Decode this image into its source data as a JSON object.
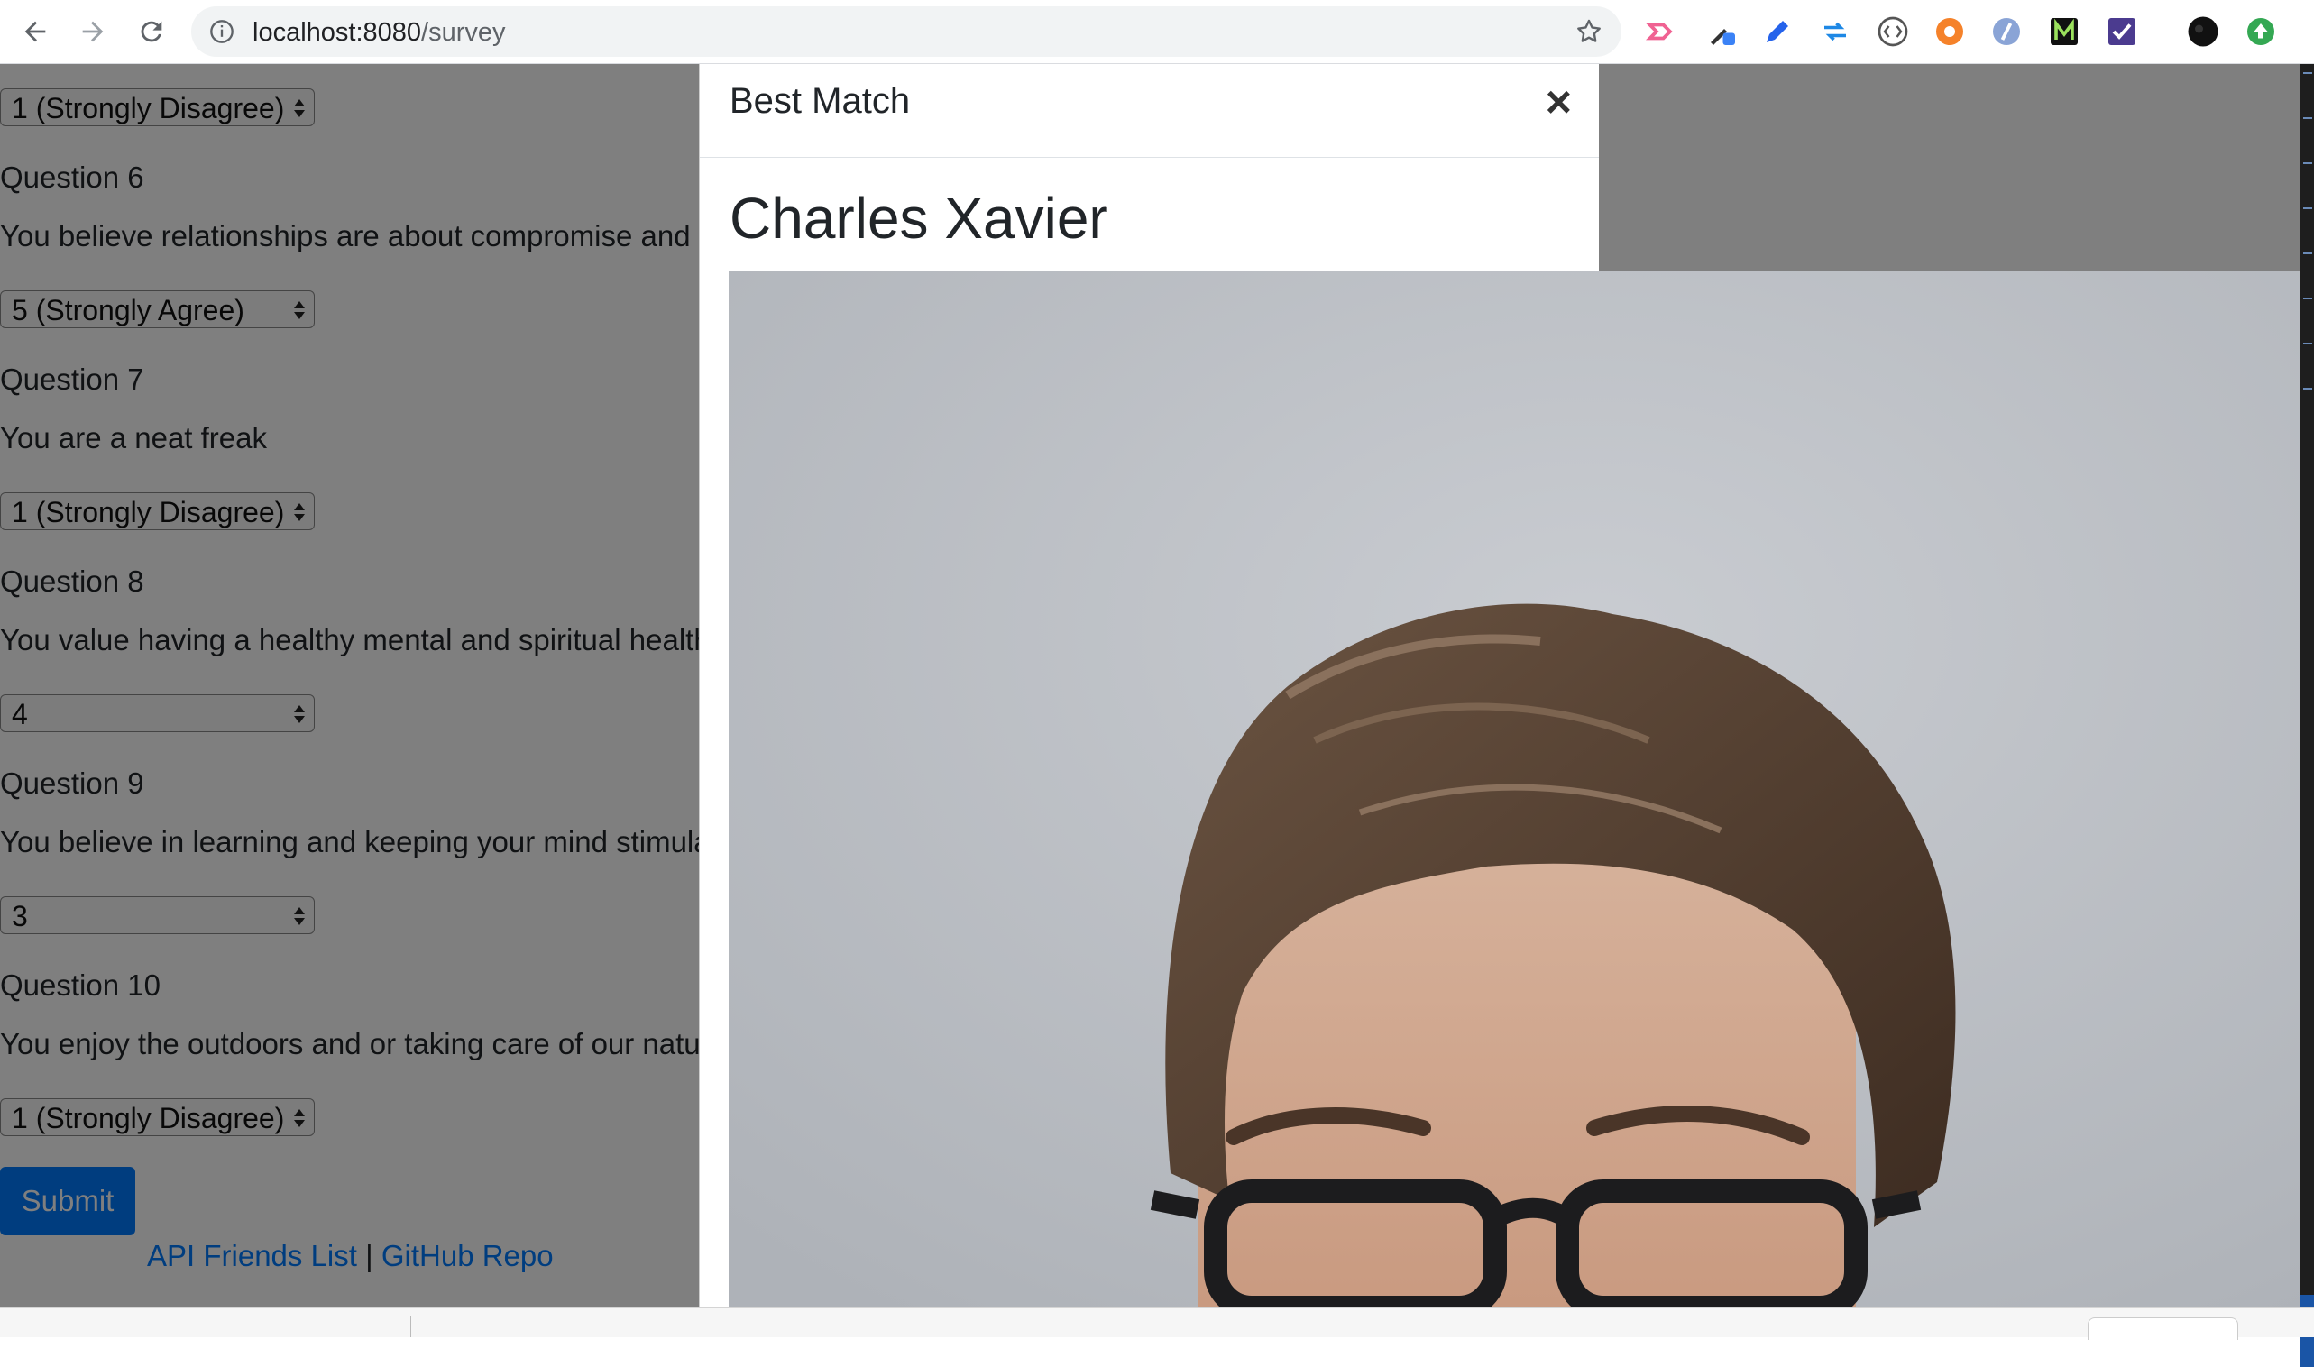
{
  "browser": {
    "url_host": "localhost:8080",
    "url_path": "/survey"
  },
  "survey": {
    "top_select": "1 (Strongly Disagree)",
    "questions": [
      {
        "label": "Question 6",
        "text": "You believe relationships are about compromise and m",
        "answer": "5 (Strongly Agree)"
      },
      {
        "label": "Question 7",
        "text": "You are a neat freak",
        "answer": "1 (Strongly Disagree)"
      },
      {
        "label": "Question 8",
        "text": "You value having a healthy mental and spiritual health",
        "answer": "4"
      },
      {
        "label": "Question 9",
        "text": "You believe in learning and keeping your mind stimulat",
        "answer": "3"
      },
      {
        "label": "Question 10",
        "text": "You enjoy the outdoors and or taking care of our natur",
        "answer": "1 (Strongly Disagree)"
      }
    ],
    "submit_label": "Submit",
    "footer": {
      "link_api": "API Friends List",
      "separator": "|",
      "link_github": "GitHub Repo"
    }
  },
  "modal": {
    "title": "Best Match",
    "close_glyph": "×",
    "match_name": "Charles Xavier"
  },
  "colors": {
    "primary": "#007bff",
    "backdrop": "rgba(0,0,0,0.5)",
    "photo_background": "#c3c6cb",
    "hair": "#5a4433"
  }
}
